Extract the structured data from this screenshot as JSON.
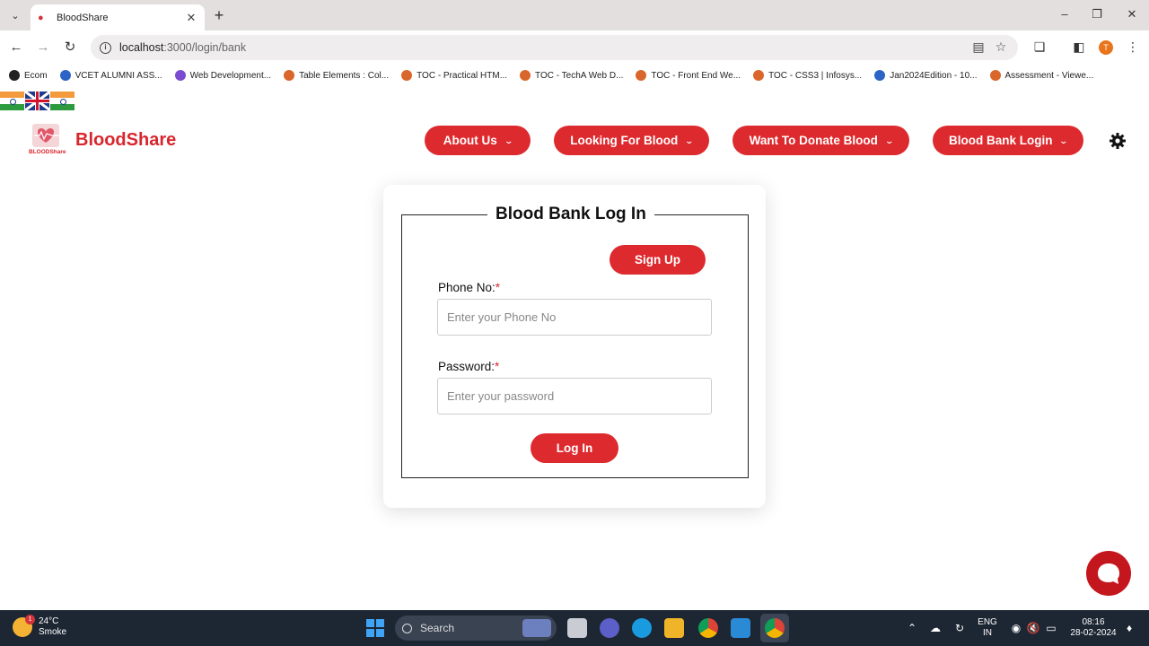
{
  "browser": {
    "tab_title": "BloodShare",
    "url_host": "localhost",
    "url_path": ":3000/login/bank",
    "profile_initial": "T",
    "bookmarks": [
      "Ecom",
      "VCET ALUMNI ASS...",
      "Web Development...",
      "Table Elements : Col...",
      "TOC - Practical HTM...",
      "TOC - TechA Web D...",
      "TOC - Front End We...",
      "TOC - CSS3 | Infosys...",
      "Jan2024Edition - 10...",
      "Assessment - Viewe..."
    ]
  },
  "site": {
    "brand": "BloodShare",
    "logo_text": "BLOODShare",
    "nav": [
      {
        "label": "About Us"
      },
      {
        "label": "Looking For Blood"
      },
      {
        "label": "Want To Donate Blood"
      },
      {
        "label": "Blood Bank Login"
      }
    ]
  },
  "login": {
    "title": "Blood Bank Log In",
    "signup_label": "Sign Up",
    "phone_label": "Phone No:",
    "phone_placeholder": "Enter your Phone No",
    "password_label": "Password:",
    "password_placeholder": "Enter your password",
    "required_mark": "*",
    "login_label": "Log In"
  },
  "taskbar": {
    "temperature": "24°C",
    "weather": "Smoke",
    "weather_badge": "1",
    "search_label": "Search",
    "lang_line1": "ENG",
    "lang_line2": "IN",
    "time": "08:16",
    "date": "28-02-2024"
  },
  "colors": {
    "brand_red": "#dd2a2e",
    "taskbar_bg": "#1d2633"
  }
}
